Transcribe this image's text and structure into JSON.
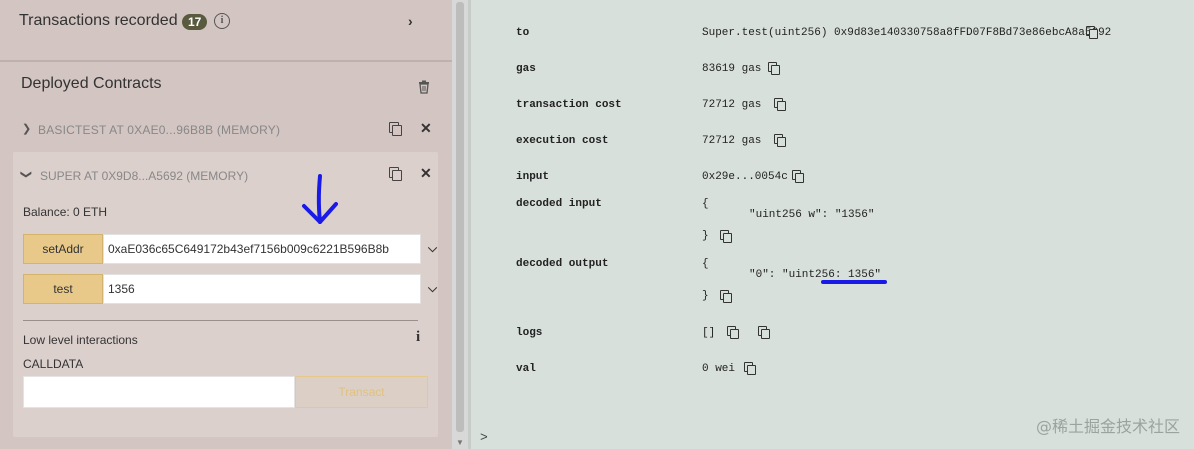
{
  "left": {
    "transactions": {
      "title": "Transactions recorded",
      "count": "17"
    },
    "deployed": {
      "title": "Deployed Contracts"
    },
    "contracts": [
      {
        "label": "BASICTEST AT 0XAE0...96B8B (MEMORY)"
      },
      {
        "label": "SUPER AT 0X9D8...A5692 (MEMORY)"
      }
    ],
    "balance": "Balance: 0 ETH",
    "functions": [
      {
        "name": "setAddr",
        "value": "0xaE036c65C649172b43ef7156b009c6221B596B8b"
      },
      {
        "name": "test",
        "value": "1356"
      }
    ],
    "low_level": "Low level interactions",
    "calldata_label": "CALLDATA",
    "transact_label": "Transact"
  },
  "right": {
    "rows": {
      "to": {
        "key": "to",
        "value": "Super.test(uint256) 0x9d83e140330758a8fFD07F8Bd73e86ebcA8a5692"
      },
      "gas": {
        "key": "gas",
        "value": "83619 gas"
      },
      "transaction_cost": {
        "key": "transaction cost",
        "value": "72712 gas"
      },
      "execution_cost": {
        "key": "execution cost",
        "value": "72712 gas"
      },
      "input": {
        "key": "input",
        "value": "0x29e...0054c"
      },
      "decoded_input": {
        "key": "decoded input",
        "open": "{",
        "body": "\"uint256 w\": \"1356\"",
        "close": "}"
      },
      "decoded_output": {
        "key": "decoded output",
        "open": "{",
        "body": "\"0\": \"uint256: 1356\"",
        "close": "}"
      },
      "logs": {
        "key": "logs",
        "value": "[]"
      },
      "val": {
        "key": "val",
        "value": "0 wei"
      }
    },
    "prompt": ">",
    "watermark": "@稀土掘金技术社区"
  },
  "colors": {
    "accent_button": "#e8c98a",
    "annotation_blue": "#1a1ae6"
  }
}
